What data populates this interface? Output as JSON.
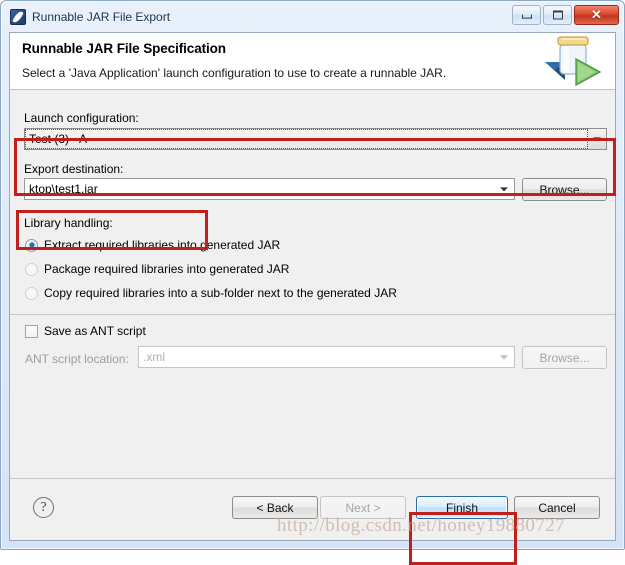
{
  "window": {
    "title": "Runnable JAR File Export",
    "app_icon": "eclipse-icon",
    "minimize_label": "",
    "maximize_label": "",
    "close_label": "✕"
  },
  "header": {
    "title": "Runnable JAR File Specification",
    "description": "Select a 'Java Application' launch configuration to use to create a runnable JAR.",
    "icon": "jar-with-green-arrow-icon"
  },
  "launch": {
    "label": "Launch configuration:",
    "value": "Test (3) - A"
  },
  "destination": {
    "label": "Export destination:",
    "value": "ktop\\test1.jar",
    "browse_label": "Browse..."
  },
  "library": {
    "label": "Library handling:",
    "options": [
      {
        "label": "Extract required libraries into generated JAR",
        "checked": true
      },
      {
        "label": "Package required libraries into generated JAR",
        "checked": false
      },
      {
        "label": "Copy required libraries into a sub-folder next to the generated JAR",
        "checked": false
      }
    ]
  },
  "ant": {
    "save_label": "Save as ANT script",
    "save_checked": false,
    "location_label": "ANT script location:",
    "location_value": ".xml",
    "browse_label": "Browse..."
  },
  "footer": {
    "help_label": "?",
    "back_label": "< Back",
    "next_label": "Next >",
    "finish_label": "Finish",
    "cancel_label": "Cancel"
  },
  "watermark": {
    "text": "http://blog.csdn.net/honey19880727"
  },
  "colors": {
    "annotation_red": "#c0201c",
    "default_button_border": "#2a6ca8",
    "radio_dot": "#2f6fa8"
  }
}
